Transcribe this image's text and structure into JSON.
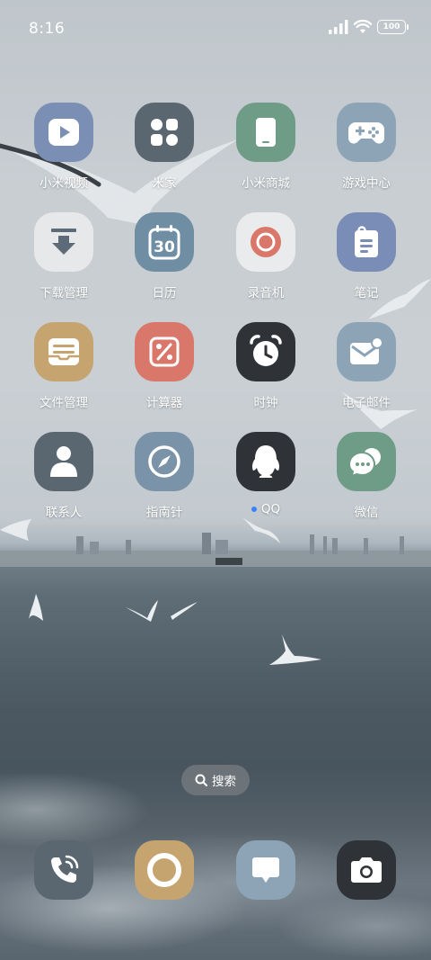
{
  "status_bar": {
    "time": "8:16",
    "battery_level": "100",
    "icons": [
      "signal-icon",
      "wifi-icon",
      "battery-icon"
    ]
  },
  "apps": [
    {
      "label": "小米视频",
      "icon": "play-icon",
      "color": "#7b8fb5"
    },
    {
      "label": "米家",
      "icon": "mijia-icon",
      "color": "#5a6670"
    },
    {
      "label": "小米商城",
      "icon": "tablet-icon",
      "color": "#6f9c86"
    },
    {
      "label": "游戏中心",
      "icon": "gamepad-icon",
      "color": "#8ca4b6"
    },
    {
      "label": "下载管理",
      "icon": "download-icon",
      "color": "#e6e8ea"
    },
    {
      "label": "日历",
      "icon": "calendar-icon",
      "color": "#6f8ea4",
      "value": "30"
    },
    {
      "label": "录音机",
      "icon": "record-icon",
      "color": "#e9ebec"
    },
    {
      "label": "笔记",
      "icon": "notes-icon",
      "color": "#7a8db6"
    },
    {
      "label": "文件管理",
      "icon": "folder-icon",
      "color": "#c6a470"
    },
    {
      "label": "计算器",
      "icon": "percent-icon",
      "color": "#d9786a"
    },
    {
      "label": "时钟",
      "icon": "alarm-clock-icon",
      "color": "#2f3236"
    },
    {
      "label": "电子邮件",
      "icon": "mail-icon",
      "color": "#8ca4b6"
    },
    {
      "label": "联系人",
      "icon": "person-icon",
      "color": "#5a6670"
    },
    {
      "label": "指南针",
      "icon": "compass-icon",
      "color": "#7b93a8"
    },
    {
      "label": "QQ",
      "icon": "qq-penguin-icon",
      "color": "#2f3236",
      "notification_dot": "#3b82f6"
    },
    {
      "label": "微信",
      "icon": "wechat-icon",
      "color": "#6f9c86"
    }
  ],
  "search": {
    "label": "搜索"
  },
  "dock": [
    {
      "icon": "phone-icon",
      "color": "#5a6670"
    },
    {
      "icon": "browser-ring-icon",
      "color": "#c6a470"
    },
    {
      "icon": "message-icon",
      "color": "#8ca4b6"
    },
    {
      "icon": "camera-icon",
      "color": "#2f3236"
    }
  ]
}
